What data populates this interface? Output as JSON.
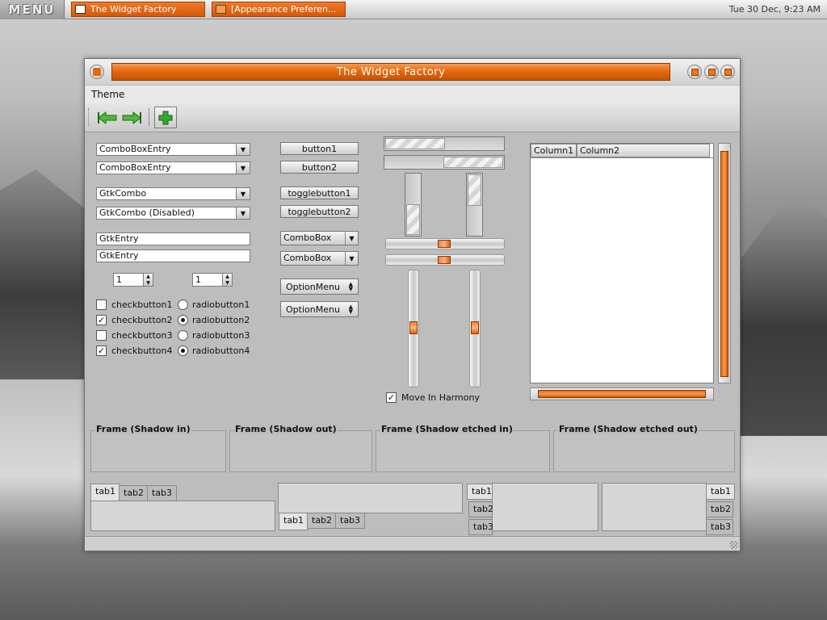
{
  "panel": {
    "menu_label": "MENU",
    "tasks": [
      "The Widget Factory",
      "[Appearance Preferen..."
    ],
    "clock": "Tue 30 Dec,  9:23 AM"
  },
  "window": {
    "title": "The Widget Factory",
    "menu": [
      "Theme"
    ]
  },
  "left": {
    "comboboxentries": [
      "ComboBoxEntry",
      "ComboBoxEntry"
    ],
    "gtkcombos": [
      "GtkCombo",
      "GtkCombo (Disabled)"
    ],
    "entries": [
      "GtkEntry",
      "GtkEntry"
    ],
    "spinbuttons": [
      "1",
      "1"
    ],
    "checkbuttons": [
      {
        "label": "checkbutton1",
        "checked": false
      },
      {
        "label": "checkbutton2",
        "checked": true
      },
      {
        "label": "checkbutton3",
        "checked": false
      },
      {
        "label": "checkbutton4",
        "checked": true
      }
    ],
    "radiobuttons": [
      {
        "label": "radiobutton1",
        "selected": false
      },
      {
        "label": "radiobutton2",
        "selected": true
      },
      {
        "label": "radiobutton3",
        "selected": false
      },
      {
        "label": "radiobutton4",
        "selected": true
      }
    ]
  },
  "middle": {
    "buttons": [
      "button1",
      "button2"
    ],
    "togglebuttons": [
      "togglebutton1",
      "togglebutton2"
    ],
    "comboboxes": [
      "ComboBox",
      "ComboBox"
    ],
    "optionmenus": [
      "OptionMenu",
      "OptionMenu"
    ]
  },
  "ranges": {
    "hprogress": [
      0.5,
      0.5
    ],
    "vprogress": [
      0.5,
      0.5
    ],
    "hscale": [
      0.5,
      0.5
    ],
    "vscale": [
      0.5,
      0.5
    ],
    "harmony_label": "Move In Harmony",
    "harmony_checked": true
  },
  "tree": {
    "columns": [
      "Column1",
      "Column2"
    ]
  },
  "frames": [
    "Frame (Shadow in)",
    "Frame (Shadow out)",
    "Frame (Shadow etched in)",
    "Frame (Shadow etched out)"
  ],
  "notebooks": {
    "tabs": [
      "tab1",
      "tab2",
      "tab3"
    ]
  },
  "colors": {
    "accent": "#e36a10",
    "window_bg": "#bdbdbd"
  }
}
